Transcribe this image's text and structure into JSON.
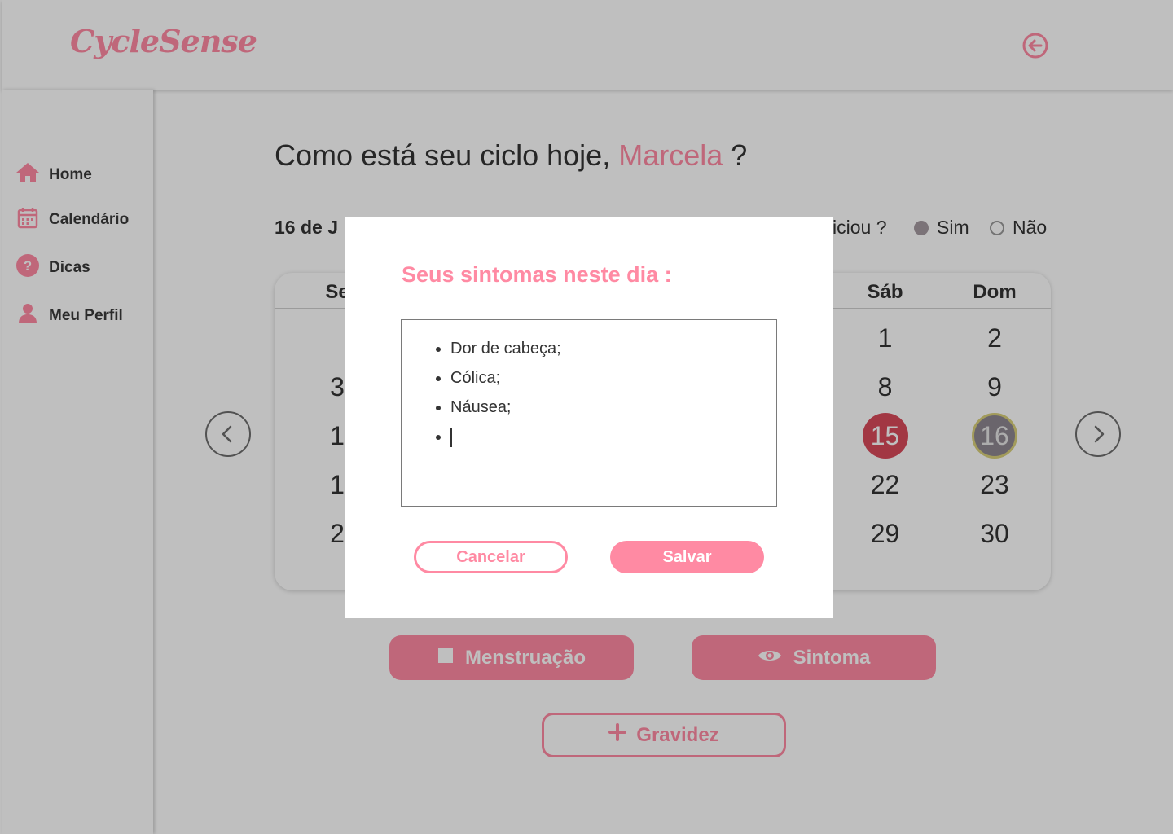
{
  "app": {
    "brand": "CycleSense"
  },
  "header": {
    "logout_icon": "logout-icon"
  },
  "sidebar": {
    "items": [
      {
        "label": "Home",
        "icon": "home-icon"
      },
      {
        "label": "Calendário",
        "icon": "calendar-icon"
      },
      {
        "label": "Dicas",
        "icon": "question-icon"
      },
      {
        "label": "Meu Perfil",
        "icon": "user-icon"
      }
    ]
  },
  "main": {
    "greeting_prefix": "Como está seu ciclo hoje, ",
    "user_name": "Marcela",
    "greeting_suffix": " ?",
    "date_visible": "16 de J",
    "question_visible": "iciou ?",
    "radio_yes": "Sim",
    "radio_no": "Não",
    "radio_selected": "Sim"
  },
  "calendar": {
    "headers": [
      {
        "label": "Se",
        "col": 0
      },
      {
        "label": "Sáb",
        "col": 5
      },
      {
        "label": "Dom",
        "col": 6
      }
    ],
    "visible_days": [
      {
        "text": "1",
        "col": 5,
        "row": 0
      },
      {
        "text": "2",
        "col": 6,
        "row": 0
      },
      {
        "text": "3",
        "col": 0,
        "row": 1
      },
      {
        "text": "8",
        "col": 5,
        "row": 1
      },
      {
        "text": "9",
        "col": 6,
        "row": 1
      },
      {
        "text": "1",
        "col": 0,
        "row": 2
      },
      {
        "text": "15",
        "col": 5,
        "row": 2,
        "state": "marked"
      },
      {
        "text": "16",
        "col": 6,
        "row": 2,
        "state": "today"
      },
      {
        "text": "1",
        "col": 0,
        "row": 3
      },
      {
        "text": "22",
        "col": 5,
        "row": 3
      },
      {
        "text": "23",
        "col": 6,
        "row": 3
      },
      {
        "text": "2",
        "col": 0,
        "row": 4
      },
      {
        "text": "29",
        "col": 5,
        "row": 4
      },
      {
        "text": "30",
        "col": 6,
        "row": 4
      }
    ],
    "marked_color": "#d94a5a",
    "today_color": "#8e8790"
  },
  "actions": {
    "menstruacao": "Menstruação",
    "sintoma": "Sintoma",
    "gravidez": "Gravidez"
  },
  "modal": {
    "title": "Seus sintomas neste dia :",
    "symptoms": [
      "Dor de cabeça;",
      "Cólica;",
      "Náusea;",
      ""
    ],
    "cancel_label": "Cancelar",
    "save_label": "Salvar"
  },
  "colors": {
    "accent": "#ff8aa3",
    "text": "#333333"
  }
}
